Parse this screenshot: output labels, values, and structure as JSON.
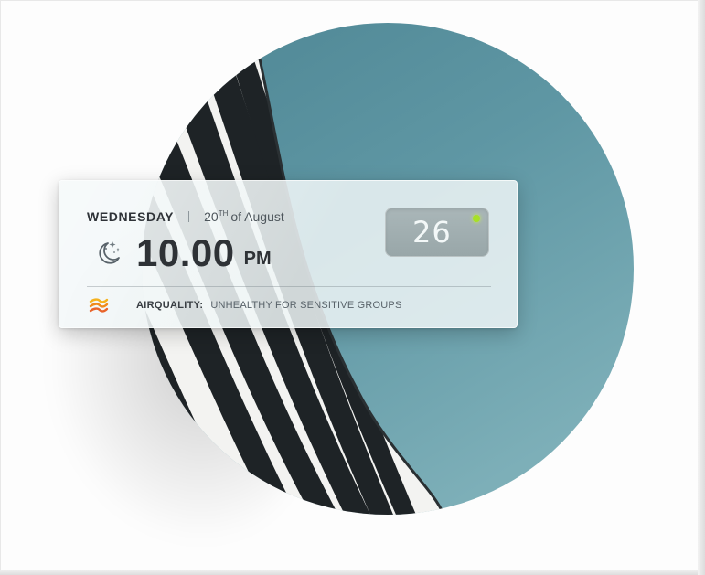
{
  "widget": {
    "day": "WEDNESDAY",
    "date_number": "20",
    "date_suffix": "TH",
    "date_rest": "of August",
    "time": "10.00",
    "meridiem": "PM",
    "weather_icon": "moon-stars-icon",
    "temperature": "26",
    "status_color": "#a7e026",
    "air_quality_icon": "air-waves-icon",
    "air_quality_label": "AIRQUALITY:",
    "air_quality_value": "UNHEALTHY FOR SENSITIVE GROUPS"
  },
  "colors": {
    "circle_teal": "#5f96a3",
    "widget_bg": "#eef5f6",
    "accent_orange": "#f08a1c"
  }
}
